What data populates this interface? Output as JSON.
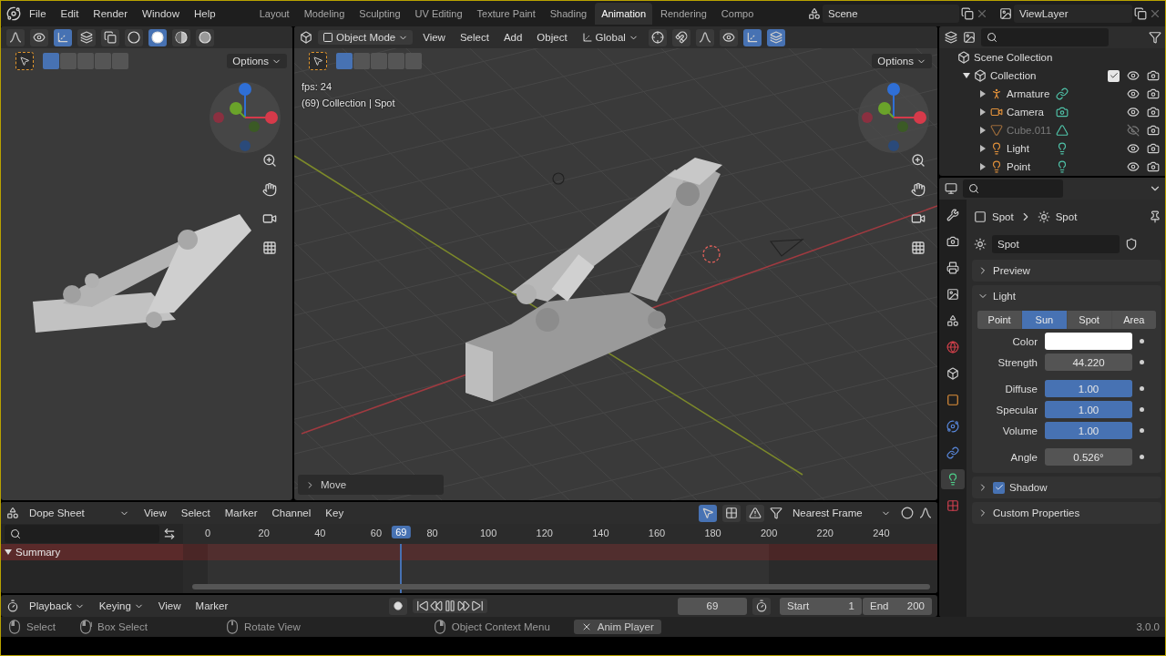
{
  "menu": [
    "File",
    "Edit",
    "Render",
    "Window",
    "Help"
  ],
  "workspaces": [
    {
      "label": "Layout",
      "selected": false
    },
    {
      "label": "Modeling",
      "selected": false
    },
    {
      "label": "Sculpting",
      "selected": false
    },
    {
      "label": "UV Editing",
      "selected": false
    },
    {
      "label": "Texture Paint",
      "selected": false
    },
    {
      "label": "Shading",
      "selected": false
    },
    {
      "label": "Animation",
      "selected": true
    },
    {
      "label": "Rendering",
      "selected": false
    },
    {
      "label": "Compo",
      "selected": false
    }
  ],
  "scene": "Scene",
  "view_layer": "ViewLayer",
  "left_viewport": {
    "toggles": [
      {
        "kind": "curve",
        "on": false
      },
      {
        "kind": "visibility",
        "on": false
      },
      {
        "kind": "gizmo",
        "on": true
      },
      {
        "kind": "overlay",
        "on": false
      },
      {
        "kind": "xray",
        "on": false
      },
      {
        "kind": "wire",
        "on": false
      },
      {
        "kind": "solid",
        "on": true
      },
      {
        "kind": "material",
        "on": false
      },
      {
        "kind": "rendered",
        "on": false
      }
    ],
    "select_modes": [
      {
        "selected": true
      },
      {
        "selected": false
      },
      {
        "selected": false
      },
      {
        "selected": false
      },
      {
        "selected": false
      }
    ],
    "options": "Options"
  },
  "main_viewport": {
    "mode": "Object Mode",
    "menus": [
      "View",
      "Select",
      "Add",
      "Object"
    ],
    "orientation": "Global",
    "toggles": [
      {
        "kind": "pivot",
        "on": false
      },
      {
        "kind": "snap",
        "on": false
      },
      {
        "kind": "proportional",
        "on": false
      },
      {
        "kind": "visibility",
        "on": false
      },
      {
        "kind": "gizmo",
        "on": true
      },
      {
        "kind": "overlay",
        "on": true
      }
    ],
    "select_modes": [
      {
        "selected": true
      },
      {
        "selected": false
      },
      {
        "selected": false
      },
      {
        "selected": false
      },
      {
        "selected": false
      }
    ],
    "options": "Options",
    "overlay": [
      "fps: 24",
      "(69) Collection | Spot"
    ],
    "last_operator": "Move"
  },
  "outliner": {
    "root": "Scene Collection",
    "collection": {
      "name": "Collection",
      "expanded": true,
      "checked": true,
      "children": [
        {
          "name": "Armature",
          "kind": "armature",
          "visible": true
        },
        {
          "name": "Camera",
          "kind": "camera",
          "visible": true
        },
        {
          "name": "Cube.011",
          "kind": "mesh",
          "visible": false
        },
        {
          "name": "Light",
          "kind": "light",
          "visible": true
        },
        {
          "name": "Point",
          "kind": "light",
          "visible": true
        }
      ]
    }
  },
  "properties": {
    "tabs": [
      {
        "kind": "tool",
        "selected": false
      },
      {
        "kind": "render",
        "selected": false
      },
      {
        "kind": "output",
        "selected": false
      },
      {
        "kind": "view_layer",
        "selected": false
      },
      {
        "kind": "scene",
        "selected": false
      },
      {
        "kind": "world",
        "selected": false
      },
      {
        "kind": "collection",
        "selected": false
      },
      {
        "kind": "object",
        "selected": false
      },
      {
        "kind": "physics",
        "selected": false
      },
      {
        "kind": "constraints",
        "selected": false
      },
      {
        "kind": "data",
        "selected": true
      },
      {
        "kind": "texture",
        "selected": false
      }
    ],
    "breadcrumb": [
      "Spot",
      "Spot"
    ],
    "datablock": "Spot",
    "panels": [
      {
        "title": "Preview",
        "expanded": false
      },
      {
        "title": "Light",
        "expanded": true
      },
      {
        "title": "Shadow",
        "expanded": false,
        "checked": true
      },
      {
        "title": "Custom Properties",
        "expanded": false
      }
    ],
    "light_types": [
      {
        "label": "Point",
        "selected": false
      },
      {
        "label": "Sun",
        "selected": true
      },
      {
        "label": "Spot",
        "selected": false
      },
      {
        "label": "Area",
        "selected": false
      }
    ],
    "fields": [
      {
        "label": "Color",
        "kind": "color",
        "color": "#ffffff"
      },
      {
        "label": "Strength",
        "kind": "number",
        "value": "44.220"
      },
      {
        "label": "Diffuse",
        "kind": "slider",
        "value": "1.00",
        "level": 1
      },
      {
        "label": "Specular",
        "kind": "slider",
        "value": "1.00",
        "level": 1
      },
      {
        "label": "Volume",
        "kind": "slider",
        "value": "1.00",
        "level": 1
      },
      {
        "label": "Angle",
        "kind": "number",
        "value": "0.526°"
      }
    ]
  },
  "dope_sheet": {
    "mode": "Dope Sheet",
    "menus": [
      "View",
      "Select",
      "Marker",
      "Channel",
      "Key"
    ],
    "toggles": [
      {
        "kind": "only_selected",
        "on": true
      },
      {
        "kind": "hidden",
        "on": false
      },
      {
        "kind": "errors",
        "on": false
      }
    ],
    "snap": "Nearest Frame",
    "ticks": [
      "0",
      "20",
      "40",
      "60",
      "80",
      "100",
      "120",
      "140",
      "160",
      "180",
      "200",
      "220",
      "240"
    ],
    "current_frame": "69",
    "playhead": {
      "level": 0.289
    },
    "channels": [
      {
        "name": "Summary",
        "expanded": true
      }
    ]
  },
  "timeline": {
    "menus": [
      {
        "label": "Playback",
        "kind": "dropdown"
      },
      {
        "label": "Keying",
        "kind": "dropdown"
      },
      {
        "label": "View",
        "kind": "menu"
      },
      {
        "label": "Marker",
        "kind": "menu"
      }
    ],
    "playing": true,
    "frame": "69",
    "start_label": "Start",
    "start": "1",
    "end_label": "End",
    "end": "200"
  },
  "status_bar": {
    "hints": [
      {
        "label": "Select",
        "kind": "left"
      },
      {
        "label": "Box Select",
        "kind": "drag"
      },
      {
        "label": "Rotate View",
        "kind": "middle"
      },
      {
        "label": "Object Context Menu",
        "kind": "right"
      }
    ],
    "task": "Anim Player",
    "version": "3.0.0"
  }
}
